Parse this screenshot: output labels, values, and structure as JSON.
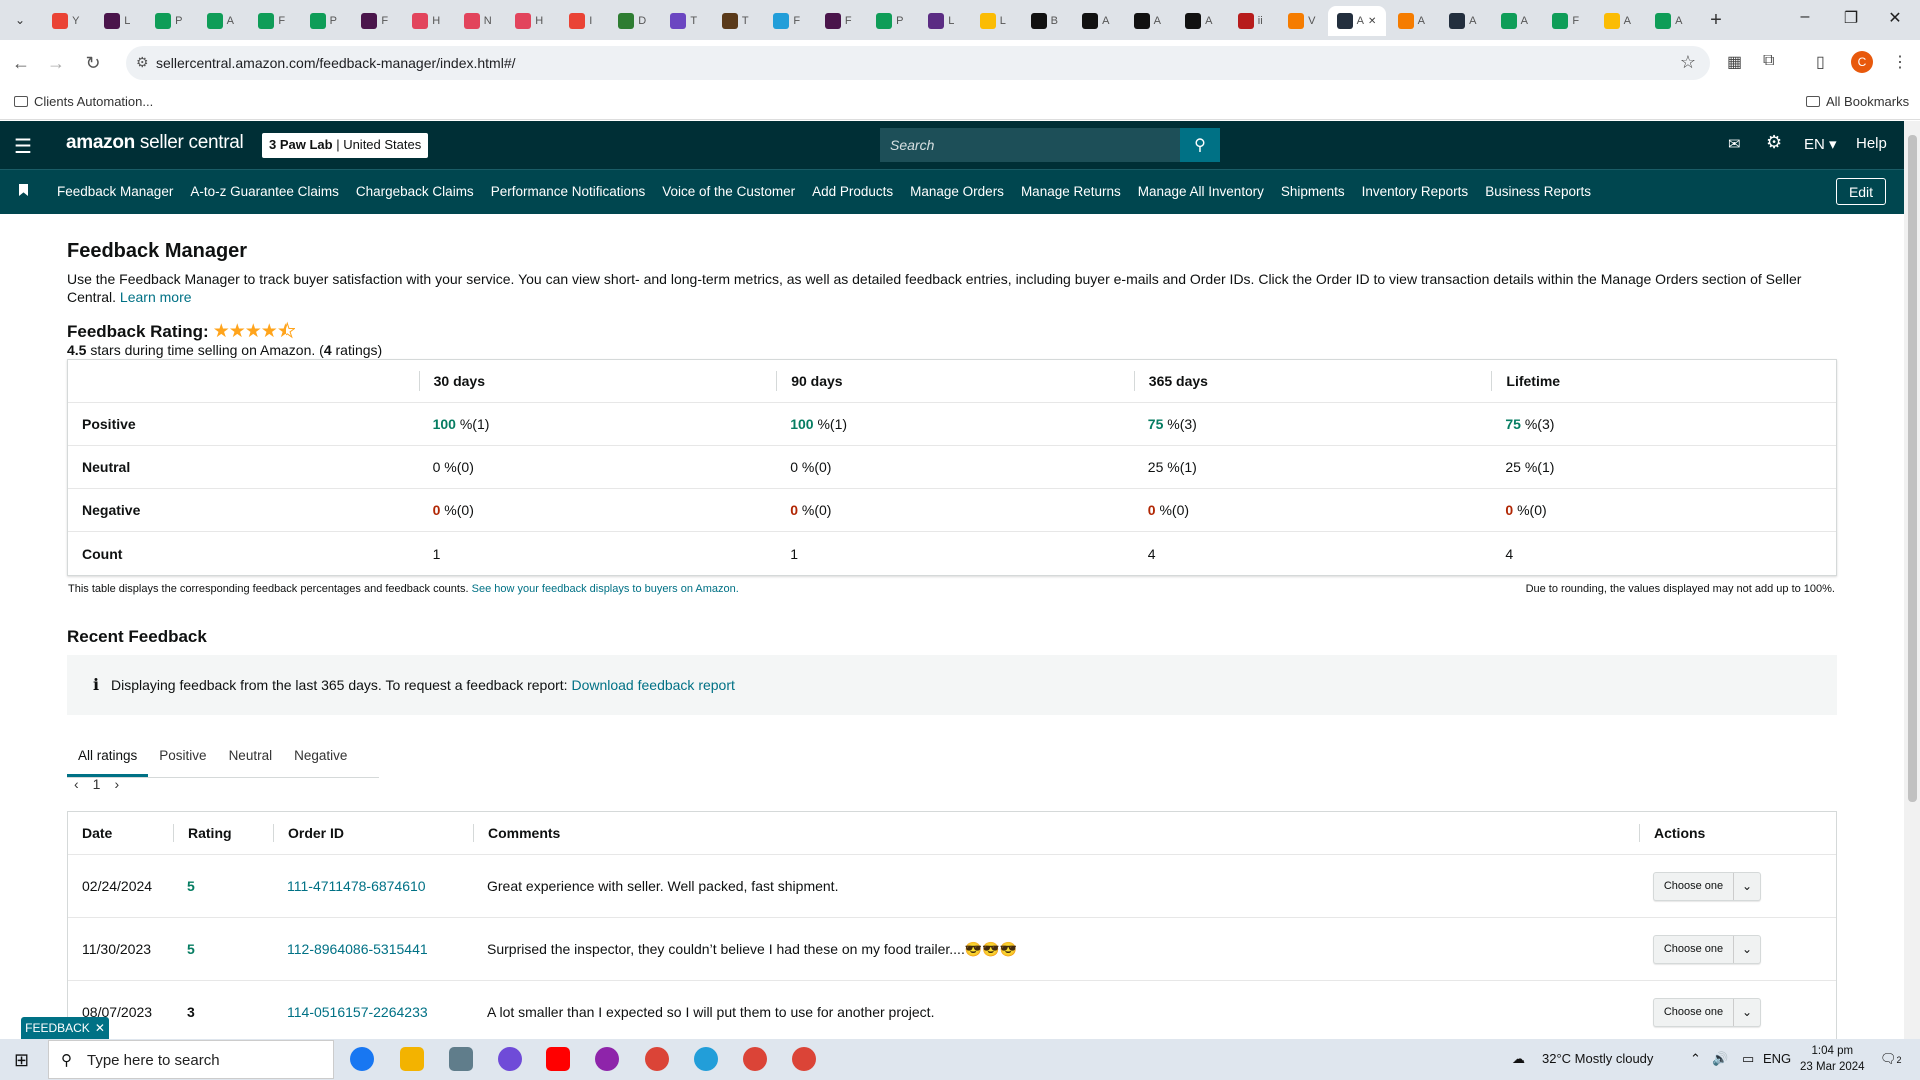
{
  "browser": {
    "tabs": [
      {
        "label": "Y",
        "color": "#ea4335"
      },
      {
        "label": "L",
        "color": "#4a154b"
      },
      {
        "label": "P",
        "color": "#0f9d58"
      },
      {
        "label": "A",
        "color": "#0f9d58"
      },
      {
        "label": "F",
        "color": "#0f9d58"
      },
      {
        "label": "P",
        "color": "#0f9d58"
      },
      {
        "label": "F",
        "color": "#4a154b"
      },
      {
        "label": "H",
        "color": "#e2445c"
      },
      {
        "label": "N",
        "color": "#e2445c"
      },
      {
        "label": "H",
        "color": "#e2445c"
      },
      {
        "label": "I",
        "color": "#ea4335"
      },
      {
        "label": "D",
        "color": "#2e7d32"
      },
      {
        "label": "T",
        "color": "#6b46c1"
      },
      {
        "label": "T",
        "color": "#5a3a1a"
      },
      {
        "label": "F",
        "color": "#229ed9"
      },
      {
        "label": "F",
        "color": "#4a154b"
      },
      {
        "label": "P",
        "color": "#0f9d58"
      },
      {
        "label": "L",
        "color": "#5b2c83"
      },
      {
        "label": "L",
        "color": "#fbbc04"
      },
      {
        "label": "B",
        "color": "#111111"
      },
      {
        "label": "A",
        "color": "#111111"
      },
      {
        "label": "A",
        "color": "#111111"
      },
      {
        "label": "A",
        "color": "#111111"
      },
      {
        "label": "ii",
        "color": "#b71c1c"
      },
      {
        "label": "V",
        "color": "#f57c00"
      },
      {
        "label": "A",
        "color": "#232f3e",
        "active": true
      },
      {
        "label": "A",
        "color": "#f57c00"
      },
      {
        "label": "A",
        "color": "#232f3e"
      },
      {
        "label": "A",
        "color": "#0f9d58"
      },
      {
        "label": "F",
        "color": "#0f9d58"
      },
      {
        "label": "A",
        "color": "#fbbc04"
      },
      {
        "label": "A",
        "color": "#0f9d58"
      }
    ],
    "url": "sellercentral.amazon.com/feedback-manager/index.html#/",
    "profile_initial": "C",
    "bookmark_folder": "Clients Automation...",
    "all_bookmarks": "All Bookmarks"
  },
  "header": {
    "logo_amazon": "amazon",
    "logo_rest": " seller central",
    "store_name": "3 Paw Lab",
    "store_region": "United States",
    "search_placeholder": "Search",
    "language": "EN",
    "help": "Help"
  },
  "nav": {
    "items": [
      "Feedback Manager",
      "A-to-z Guarantee Claims",
      "Chargeback Claims",
      "Performance Notifications",
      "Voice of the Customer",
      "Add Products",
      "Manage Orders",
      "Manage Returns",
      "Manage All Inventory",
      "Shipments",
      "Inventory Reports",
      "Business Reports"
    ],
    "edit": "Edit"
  },
  "page": {
    "title": "Feedback Manager",
    "intro": "Use the Feedback Manager to track buyer satisfaction with your service. You can view short- and long-term metrics, as well as detailed feedback entries, including buyer e-mails and Order IDs. Click the Order ID to view transaction details within the Manage Orders section of Seller Central.",
    "learn_more": "Learn more",
    "rating_label": "Feedback Rating:",
    "rating_value": "4.5",
    "rating_text_mid": " stars during time selling on Amazon. (",
    "rating_count": "4",
    "rating_text_end": " ratings)"
  },
  "metrics": {
    "columns": [
      "30 days",
      "90 days",
      "365 days",
      "Lifetime"
    ],
    "rows": [
      {
        "label": "Positive",
        "cells": [
          [
            "100",
            " %(1)"
          ],
          [
            "100",
            " %(1)"
          ],
          [
            "75",
            " %(3)"
          ],
          [
            "75",
            " %(3)"
          ]
        ],
        "style": "g"
      },
      {
        "label": "Neutral",
        "cells": [
          [
            "0",
            " %(0)"
          ],
          [
            "0",
            " %(0)"
          ],
          [
            "25",
            " %(1)"
          ],
          [
            "25",
            " %(1)"
          ]
        ],
        "style": ""
      },
      {
        "label": "Negative",
        "cells": [
          [
            "0",
            " %(0)"
          ],
          [
            "0",
            " %(0)"
          ],
          [
            "0",
            " %(0)"
          ],
          [
            "0",
            " %(0)"
          ]
        ],
        "style": "r"
      },
      {
        "label": "Count",
        "cells": [
          [
            "1",
            ""
          ],
          [
            "1",
            ""
          ],
          [
            "4",
            ""
          ],
          [
            "4",
            ""
          ]
        ],
        "style": ""
      }
    ],
    "note": "This table displays the corresponding feedback percentages and feedback counts.",
    "note_link": "See how your feedback displays to buyers on Amazon.",
    "rounding": "Due to rounding, the values displayed may not add up to 100%."
  },
  "recent": {
    "title": "Recent Feedback",
    "info": "Displaying feedback from the last 365 days. To request a feedback report:",
    "download": "Download feedback report",
    "tabs": [
      "All ratings",
      "Positive",
      "Neutral",
      "Negative"
    ],
    "page": "1",
    "columns": {
      "date": "Date",
      "rating": "Rating",
      "order": "Order ID",
      "comments": "Comments",
      "actions": "Actions"
    },
    "rows": [
      {
        "date": "02/24/2024",
        "rating": "5",
        "order": "111-4711478-6874610",
        "comment": "Great experience with seller. Well packed, fast shipment.",
        "action": "Choose one"
      },
      {
        "date": "11/30/2023",
        "rating": "5",
        "order": "112-8964086-5315441",
        "comment": "Surprised the inspector, they couldn’t believe I had these on my food trailer....😎😎😎",
        "action": "Choose one"
      },
      {
        "date": "08/07/2023",
        "rating": "3",
        "order": "114-0516157-2264233",
        "comment": "A lot smaller than I expected so I will put them to use for another project.",
        "action": "Choose one"
      }
    ]
  },
  "feedback_tab": "FEEDBACK",
  "taskbar": {
    "search_placeholder": "Type here to search",
    "weather": "32°C  Mostly cloudy",
    "lang": "ENG",
    "time": "1:04 pm",
    "date": "23 Mar 2024",
    "notif_count": "2"
  }
}
